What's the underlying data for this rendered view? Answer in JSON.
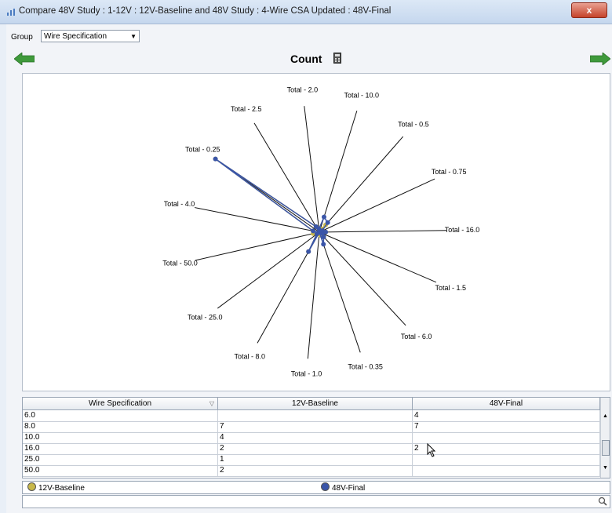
{
  "window": {
    "title": "Compare 48V Study : 1-12V : 12V-Baseline and 48V Study : 4-Wire CSA Updated : 48V-Final",
    "close_label": "x"
  },
  "toolbar": {
    "group_label": "Group",
    "group_value": "Wire Specification"
  },
  "chart": {
    "title": "Count",
    "icons": {
      "prev": "arrow-left-icon",
      "next": "arrow-right-icon",
      "calc": "calculator-icon"
    }
  },
  "chart_data": {
    "type": "radar",
    "spokes": [
      "Total - 10.0",
      "Total - 0.5",
      "Total - 0.75",
      "Total - 16.0",
      "Total - 1.5",
      "Total - 6.0",
      "Total - 0.35",
      "Total - 1.0",
      "Total - 8.0",
      "Total - 25.0",
      "Total - 50.0",
      "Total - 4.0",
      "Total - 0.25",
      "Total - 2.5",
      "Total - 2.0"
    ],
    "series": [
      {
        "name": "12V-Baseline",
        "color": "#c8b84a",
        "values": [
          1,
          3,
          1,
          2,
          1,
          2,
          1,
          0,
          7,
          1,
          2,
          2,
          40,
          2,
          1
        ]
      },
      {
        "name": "48V-Final",
        "color": "#3a55a8",
        "values": [
          5,
          4,
          1,
          2,
          1,
          2,
          4,
          0,
          7,
          1,
          0,
          2,
          40,
          2,
          1
        ]
      }
    ]
  },
  "table": {
    "columns": [
      "Wire Specification",
      "12V-Baseline",
      "48V-Final"
    ],
    "rows": [
      [
        "6.0",
        "",
        "4"
      ],
      [
        "8.0",
        "7",
        "7"
      ],
      [
        "10.0",
        "4",
        ""
      ],
      [
        "16.0",
        "2",
        "2"
      ],
      [
        "25.0",
        "1",
        ""
      ],
      [
        "50.0",
        "2",
        ""
      ]
    ]
  },
  "legend": {
    "items": [
      {
        "label": "12V-Baseline",
        "color": "#c8b84a"
      },
      {
        "label": "48V-Final",
        "color": "#3a55a8"
      }
    ]
  },
  "search": {
    "icon": "search-icon"
  }
}
